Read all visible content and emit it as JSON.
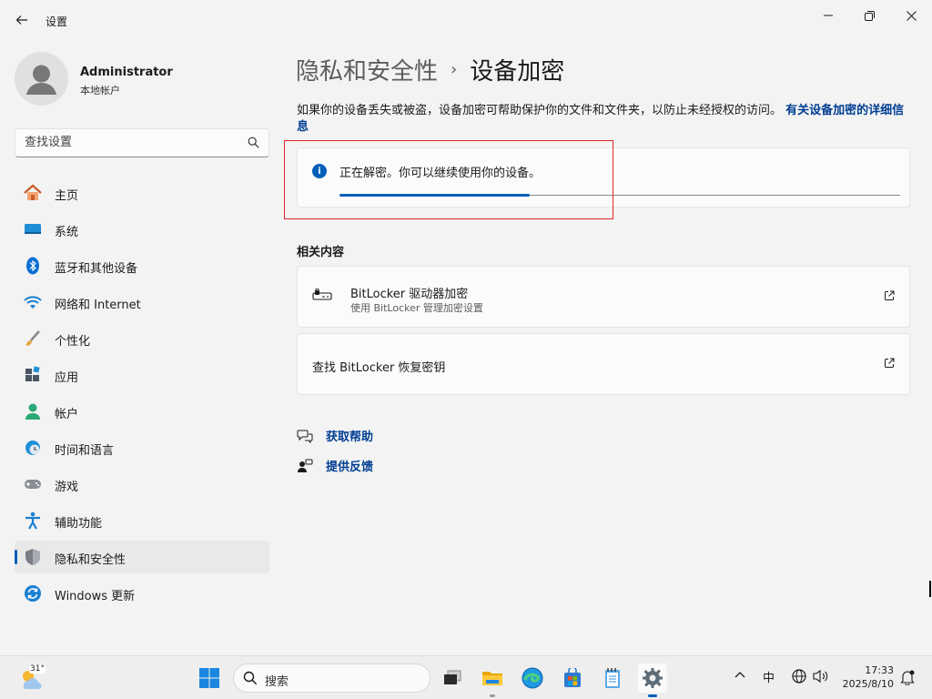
{
  "window": {
    "title": "设置"
  },
  "user": {
    "name": "Administrator",
    "account_type": "本地帐户"
  },
  "search": {
    "placeholder": "查找设置"
  },
  "sidebar": {
    "items": [
      {
        "label": "主页",
        "icon": "home-icon"
      },
      {
        "label": "系统",
        "icon": "system-icon"
      },
      {
        "label": "蓝牙和其他设备",
        "icon": "bluetooth-icon"
      },
      {
        "label": "网络和 Internet",
        "icon": "wifi-icon"
      },
      {
        "label": "个性化",
        "icon": "brush-icon"
      },
      {
        "label": "应用",
        "icon": "apps-icon"
      },
      {
        "label": "帐户",
        "icon": "account-icon"
      },
      {
        "label": "时间和语言",
        "icon": "clock-globe-icon"
      },
      {
        "label": "游戏",
        "icon": "gamepad-icon"
      },
      {
        "label": "辅助功能",
        "icon": "accessibility-icon"
      },
      {
        "label": "隐私和安全性",
        "icon": "shield-icon",
        "active": true
      },
      {
        "label": "Windows 更新",
        "icon": "update-icon"
      }
    ]
  },
  "breadcrumb": {
    "parent": "隐私和安全性",
    "separator": "›",
    "current": "设备加密"
  },
  "description": {
    "text": "如果你的设备丢失或被盗，设备加密可帮助保护你的文件和文件夹，以防止未经授权的访问。 ",
    "link": "有关设备加密的详细信息"
  },
  "status": {
    "message": "正在解密。你可以继续使用你的设备。",
    "progress": 0.34
  },
  "related": {
    "title": "相关内容",
    "items": [
      {
        "title": "BitLocker 驱动器加密",
        "subtitle": "使用 BitLocker 管理加密设置"
      },
      {
        "title": "查找 BitLocker 恢复密钥"
      }
    ]
  },
  "help": {
    "get_help": "获取帮助",
    "feedback": "提供反馈"
  },
  "taskbar": {
    "temperature": "31°",
    "search_label": "搜索",
    "input_method": "中",
    "time": "17:33",
    "date": "2025/8/10"
  },
  "colors": {
    "accent": "#005fb8",
    "link": "#003e92",
    "highlight_box": "#e1232a"
  }
}
